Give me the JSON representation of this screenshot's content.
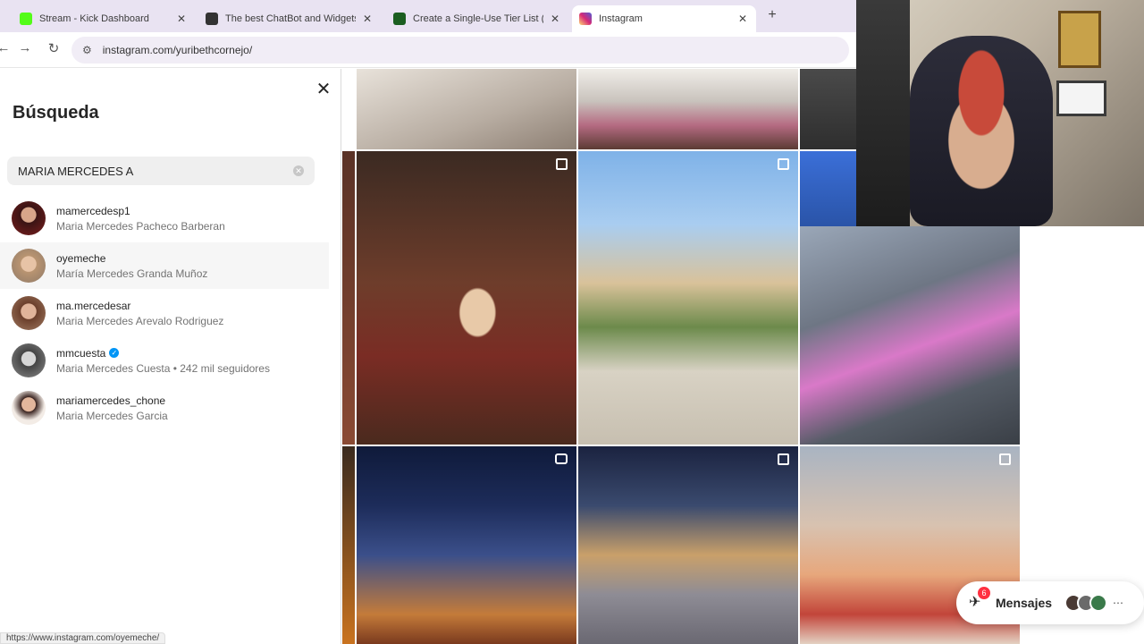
{
  "browser": {
    "tabs": [
      {
        "title": "Stream - Kick Dashboard",
        "fav_color": "#53fc18",
        "active": false
      },
      {
        "title": "The best ChatBot and Widgets",
        "fav_color": "#333333",
        "active": false
      },
      {
        "title": "Create a Single-Use Tier List (P",
        "fav_color": "#1b5e20",
        "active": false
      },
      {
        "title": "Instagram",
        "fav_color": "#d6249f",
        "active": true
      }
    ],
    "new_tab_label": "+",
    "url": "instagram.com/yuribethcornejo/"
  },
  "search_panel": {
    "title": "Búsqueda",
    "query": "MARIA MERCEDES A",
    "results": [
      {
        "username": "mamercedesp1",
        "fullname": "Maria Mercedes Pacheco Barberan",
        "verified": false,
        "avatar_color": "#6b2a2a"
      },
      {
        "username": "oyemeche",
        "fullname": "María Mercedes Granda Muñoz",
        "verified": false,
        "avatar_color": "#c9a68a"
      },
      {
        "username": "ma.mercedesar",
        "fullname": "Maria Mercedes Arevalo Rodriguez",
        "verified": false,
        "avatar_color": "#8a5a44"
      },
      {
        "username": "mmcuesta",
        "fullname": "Maria Mercedes Cuesta • 242 mil seguidores",
        "verified": true,
        "avatar_color": "#5c5c5c"
      },
      {
        "username": "mariamercedes_chone",
        "fullname": "Maria Mercedes Garcia",
        "verified": false,
        "avatar_color": "#e8dcd2"
      }
    ]
  },
  "messages": {
    "label": "Mensajes",
    "badge": "6"
  },
  "status_url": "https://www.instagram.com/oyemeche/"
}
